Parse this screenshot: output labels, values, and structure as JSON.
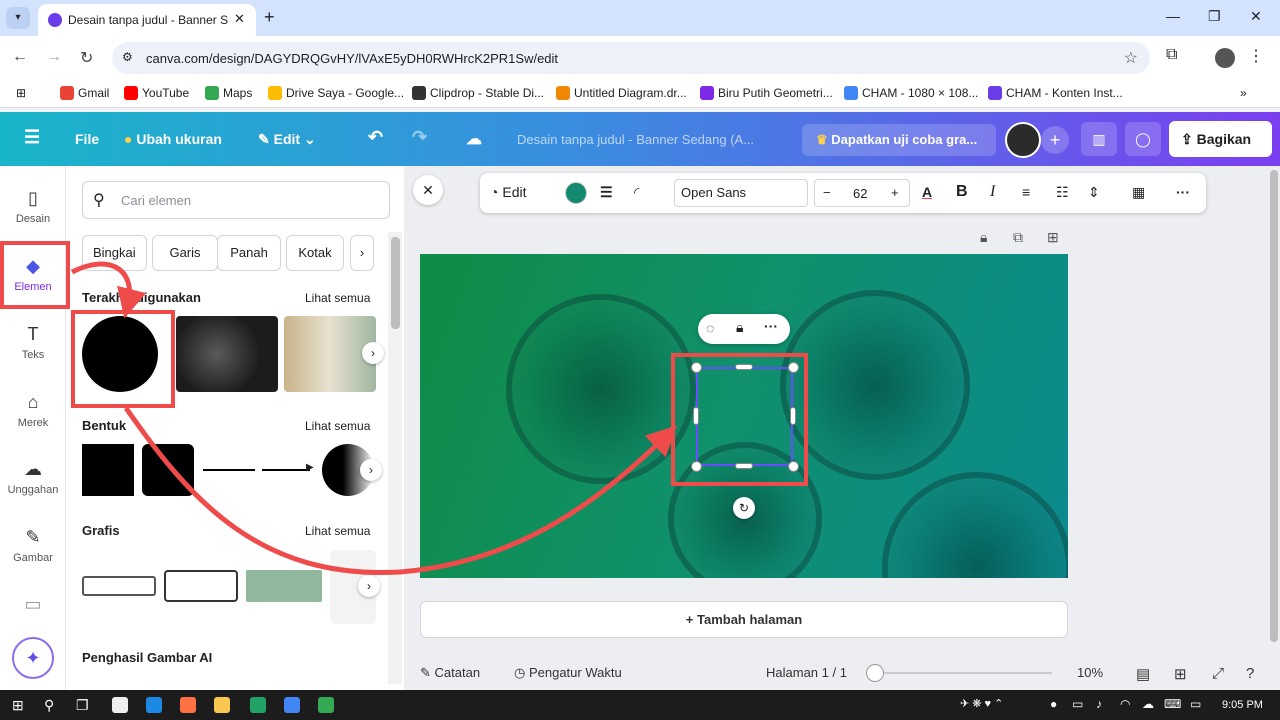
{
  "browser": {
    "tab_title": "Desain tanpa judul - Banner Se",
    "url": "canva.com/design/DAGYDRQGvHY/lVAxE5yDH0RWHrcK2PR1Sw/edit",
    "bookmarks": [
      {
        "label": "Gmail",
        "color": "#ea4335"
      },
      {
        "label": "YouTube",
        "color": "#ff0000"
      },
      {
        "label": "Maps",
        "color": "#34a853"
      },
      {
        "label": "Drive Saya - Google...",
        "color": "#fbbc04"
      },
      {
        "label": "Clipdrop - Stable Di...",
        "color": "#333333"
      },
      {
        "label": "Untitled Diagram.dr...",
        "color": "#f08705"
      },
      {
        "label": "Biru Putih Geometri...",
        "color": "#7d2ae8"
      },
      {
        "label": "CHAM - 1080 × 108...",
        "color": "#4285f4"
      },
      {
        "label": "CHAM - Konten Inst...",
        "color": "#6a3de8"
      }
    ]
  },
  "header": {
    "menu_icon": "☰",
    "file": "File",
    "resize": "Ubah ukuran",
    "edit": "Edit",
    "doc_title": "Desain tanpa judul - Banner Sedang (A...",
    "trial": "Dapatkan uji coba gra...",
    "share": "Bagikan"
  },
  "rail": [
    {
      "label": "Desain",
      "icon": "▯"
    },
    {
      "label": "Elemen",
      "icon": "◆"
    },
    {
      "label": "Teks",
      "icon": "T"
    },
    {
      "label": "Merek",
      "icon": "⌂"
    },
    {
      "label": "Unggahan",
      "icon": "☁"
    },
    {
      "label": "Gambar",
      "icon": "✎"
    }
  ],
  "panel": {
    "search_placeholder": "Cari elemen",
    "chips": [
      "Bingkai",
      "Garis",
      "Panah",
      "Kotak"
    ],
    "recent_title": "Terakhir digunakan",
    "see_all": "Lihat semua",
    "shapes_title": "Bentuk",
    "graphics_title": "Grafis",
    "ai_title": "Penghasil Gambar AI"
  },
  "toolbar": {
    "edit": "Edit",
    "font": "Open Sans",
    "size": "62",
    "minus": "−",
    "plus": "+",
    "text_color_letter": "A",
    "bold": "B",
    "italic": "I",
    "more": "···",
    "color": "#138a6f"
  },
  "editor": {
    "add_page": "+ Tambah halaman",
    "notes": "Catatan",
    "timer": "Pengatur Waktu",
    "page": "Halaman 1 / 1",
    "zoom": "10%"
  },
  "taskbar": {
    "time": "9:05 PM"
  }
}
